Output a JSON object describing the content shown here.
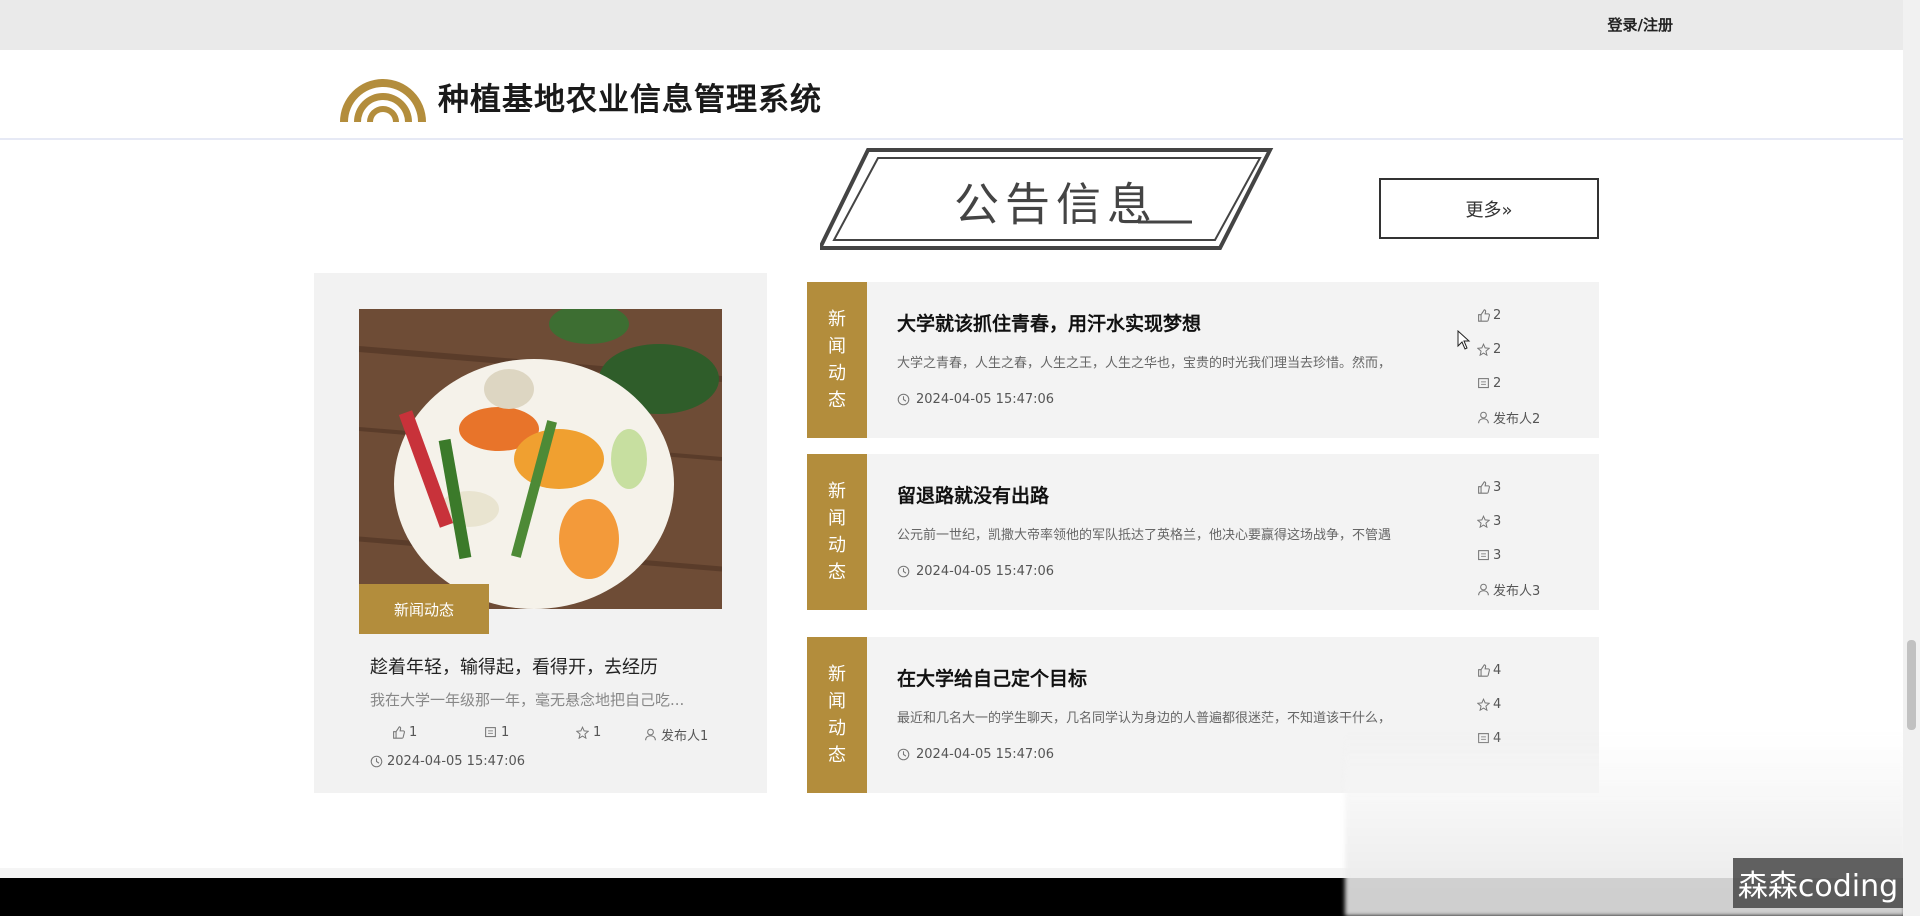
{
  "topbar": {
    "login_label": "登录/注册"
  },
  "header": {
    "site_title": "种植基地农业信息管理系统"
  },
  "section": {
    "title": "公告信息",
    "more_label": "更多»"
  },
  "featured": {
    "tag": "新闻动态",
    "title": "趁着年轻，输得起，看得开，去经历",
    "summary": "我在大学一年级那一年，毫无悬念地把自己吃...",
    "likes": "1",
    "comments": "1",
    "favorites": "1",
    "author": "发布人1",
    "date": "2024-04-05 15:47:06"
  },
  "news": [
    {
      "badge": [
        "新",
        "闻",
        "动",
        "态"
      ],
      "title": "大学就该抓住青春，用汗水实现梦想",
      "summary": "大学之青春，人生之春，人生之王，人生之华也，宝贵的时光我们理当去珍惜。然而，",
      "date": "2024-04-05 15:47:06",
      "likes": "2",
      "favorites": "2",
      "comments": "2",
      "author": "发布人2"
    },
    {
      "badge": [
        "新",
        "闻",
        "动",
        "态"
      ],
      "title": "留退路就没有出路",
      "summary": "公元前一世纪，凯撒大帝率领他的军队抵达了英格兰，他决心要赢得这场战争，不管遇",
      "date": "2024-04-05 15:47:06",
      "likes": "3",
      "favorites": "3",
      "comments": "3",
      "author": "发布人3"
    },
    {
      "badge": [
        "新",
        "闻",
        "动",
        "态"
      ],
      "title": "在大学给自己定个目标",
      "summary": "最近和几名大一的学生聊天，几名同学认为身边的人普遍都很迷茫，不知道该干什么，",
      "date": "2024-04-05 15:47:06",
      "likes": "4",
      "favorites": "4",
      "comments": "4",
      "author": ""
    }
  ],
  "watermark": "森森coding",
  "colors": {
    "accent": "#b38d3c",
    "card_bg": "#f3f3f3",
    "topbar_bg": "#eaeaea"
  }
}
